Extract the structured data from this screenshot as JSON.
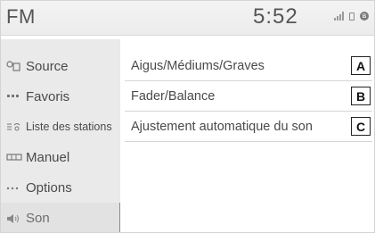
{
  "header": {
    "title": "FM",
    "clock": "5:52",
    "status_icons": [
      "signal-icon",
      "battery-icon",
      "bluetooth-icon"
    ]
  },
  "sidebar": {
    "items": [
      {
        "label": "Source",
        "icon": "source-icon"
      },
      {
        "label": "Favoris",
        "icon": "favorites-icon"
      },
      {
        "label": "Liste des stations",
        "icon": "station-list-icon"
      },
      {
        "label": "Manuel",
        "icon": "manual-tuning-icon"
      },
      {
        "label": "Options",
        "icon": "options-icon"
      },
      {
        "label": "Son",
        "icon": "sound-icon",
        "active": true
      }
    ]
  },
  "main": {
    "rows": [
      {
        "label": "Aigus/Médiums/Graves",
        "expandable": true,
        "marker": "A"
      },
      {
        "label": "Fader/Balance",
        "expandable": false,
        "marker": "B"
      },
      {
        "label": "Ajustement automatique du son",
        "expandable": true,
        "marker": "C"
      }
    ]
  },
  "colors": {
    "header_bg": "#ececec",
    "sidebar_bg": "#eaeaea",
    "text": "#4a4a4a"
  }
}
